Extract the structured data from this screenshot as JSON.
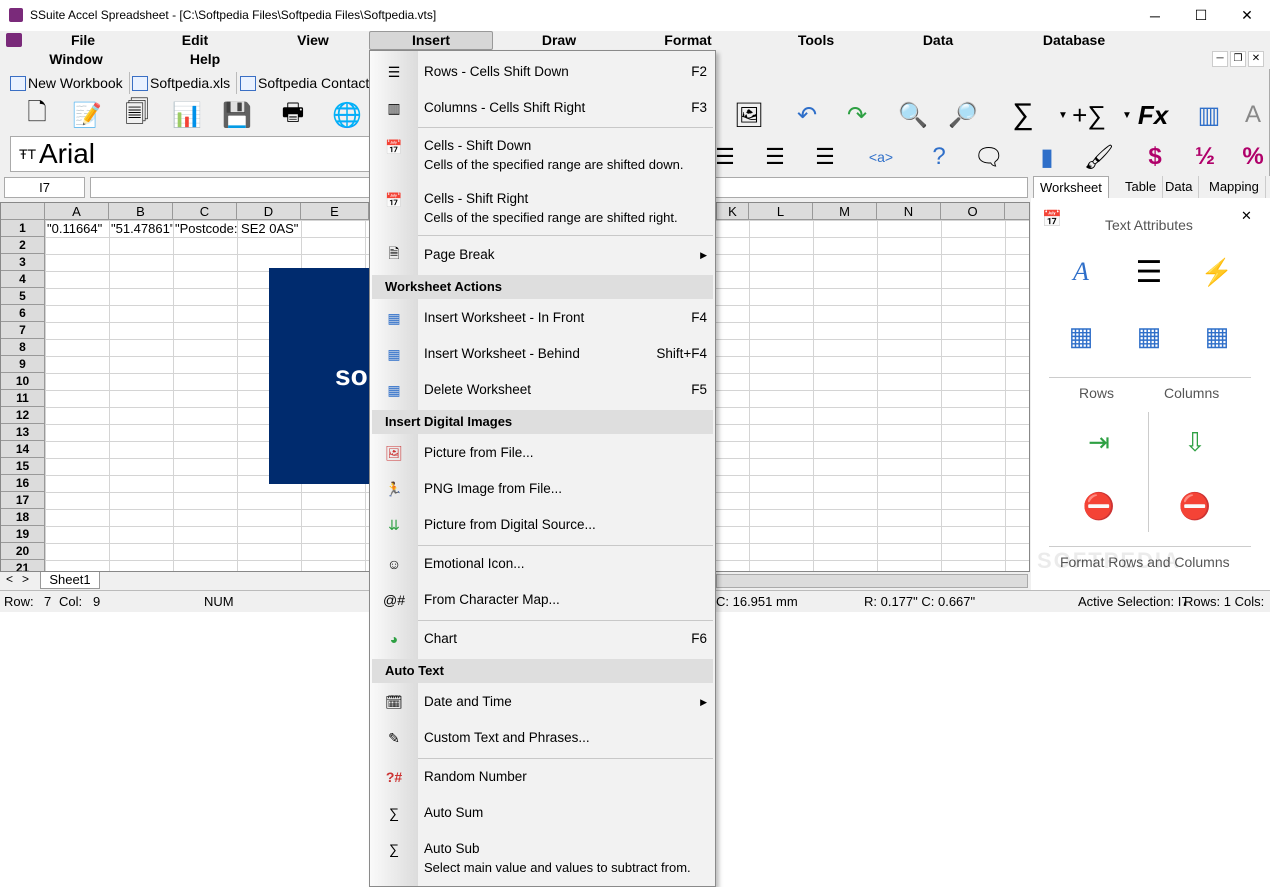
{
  "window": {
    "title": "SSuite Accel Spreadsheet - [C:\\Softpedia Files\\Softpedia Files\\Softpedia.vts]",
    "minimize": "─",
    "maximize": "☐",
    "close": "✕"
  },
  "menubar": {
    "items": [
      "File",
      "Edit",
      "View",
      "Insert",
      "Draw",
      "Format",
      "Tools",
      "Data",
      "Database",
      "Window",
      "Help"
    ]
  },
  "workbook_tabs": [
    "New Workbook",
    "Softpedia.xls",
    "Softpedia Contact..."
  ],
  "font": {
    "name": "Arial",
    "icon": "font-icon"
  },
  "cell_ref": "I7",
  "columns": [
    "A",
    "B",
    "C",
    "D",
    "E",
    "K",
    "L",
    "M",
    "N",
    "O"
  ],
  "rows": [
    "1",
    "2",
    "3",
    "4",
    "5",
    "6",
    "7",
    "8",
    "9",
    "10",
    "11",
    "12",
    "13",
    "14",
    "15",
    "16",
    "17",
    "18",
    "19",
    "20",
    "21"
  ],
  "cells": {
    "a1": "\"0.11664\"",
    "b1": "\"51.47861\"",
    "c1": "\"Postcode: SE2 0AS\""
  },
  "logo_text": "so",
  "sheet_tab": "Sheet1",
  "sheet_nav": {
    "prev": "<",
    "next": ">"
  },
  "statusbar": {
    "row_label": "Row:",
    "row_value": "7",
    "col_label": "Col:",
    "col_value": "9",
    "num": "NUM",
    "size": "C: 16.951 mm",
    "rc": "R: 0.177\"   C: 0.667\"",
    "active": "Active Selection: I7",
    "rows_cols": "Rows: 1  Cols:"
  },
  "side_panel": {
    "tabs": [
      "Worksheet",
      "Table",
      "Data",
      "Mapping"
    ],
    "section_title": "Text Attributes",
    "close": "✕",
    "rows_label": "Rows",
    "columns_label": "Columns",
    "footer": "Format Rows and Columns"
  },
  "insert_menu": {
    "items": [
      {
        "label": "Rows - Cells Shift Down",
        "shortcut": "F2"
      },
      {
        "label": "Columns - Cells Shift Right",
        "shortcut": "F3"
      },
      {
        "label": "Cells - Shift Down",
        "desc": "Cells of the specified range are shifted down."
      },
      {
        "label": "Cells - Shift Right",
        "desc": "Cells of the specified range are shifted right."
      },
      {
        "label": "Page Break"
      },
      {
        "label": "Insert Worksheet - In Front",
        "shortcut": "F4"
      },
      {
        "label": "Insert Worksheet - Behind",
        "shortcut": "Shift+F4"
      },
      {
        "label": "Delete Worksheet",
        "shortcut": "F5"
      },
      {
        "label": "Picture from File..."
      },
      {
        "label": "PNG Image from File..."
      },
      {
        "label": "Picture from Digital Source..."
      },
      {
        "label": "Emotional Icon..."
      },
      {
        "label": "From Character Map..."
      },
      {
        "label": "Chart",
        "shortcut": "F6"
      },
      {
        "label": "Date and Time"
      },
      {
        "label": "Custom Text and Phrases..."
      },
      {
        "label": "Random Number"
      },
      {
        "label": "Auto Sum"
      },
      {
        "label": "Auto Sub",
        "desc": "Select main value and values to subtract from."
      }
    ],
    "headers": [
      "Worksheet Actions",
      "Insert Digital Images",
      "Auto Text"
    ],
    "submenu_arrow": "▶"
  },
  "watermark": "SOFTPEDIA"
}
